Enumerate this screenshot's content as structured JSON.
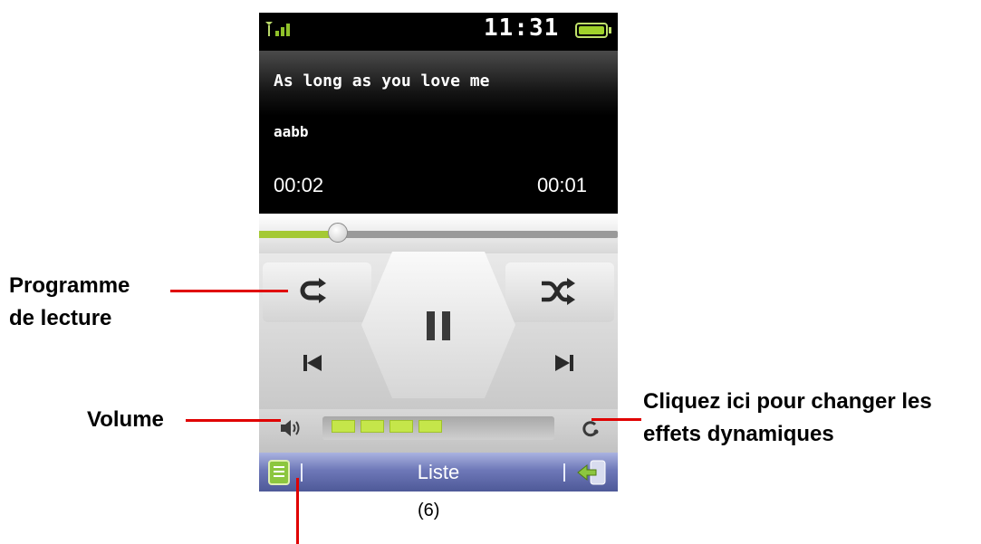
{
  "status": {
    "time": "11:31"
  },
  "track": {
    "title": "As long as you love me",
    "artist": "aabb",
    "elapsed": "00:02",
    "remaining": "00:01",
    "progress": 0.22
  },
  "volume": {
    "level": 4,
    "max": 4
  },
  "bottom": {
    "label": "Liste"
  },
  "annotations": {
    "playmode": "Programme\nde lecture",
    "playmode_line1": "Programme",
    "playmode_line2": "de lecture",
    "volume": "Volume",
    "effects_line1": "Cliquez ici pour changer les",
    "effects_line2": "effets dynamiques",
    "figure": "(6)"
  },
  "icons": {
    "signal": "signal-icon",
    "battery": "battery-icon",
    "repeat": "repeat-icon",
    "shuffle": "shuffle-icon",
    "pause": "pause-icon",
    "prev": "previous-icon",
    "next": "next-icon",
    "speaker": "speaker-icon",
    "effects": "effects-icon",
    "list": "list-icon",
    "back": "back-icon"
  },
  "colors": {
    "accent": "#a4c934",
    "annotation_line": "#e00000",
    "bottombar": "#6e78b8"
  }
}
